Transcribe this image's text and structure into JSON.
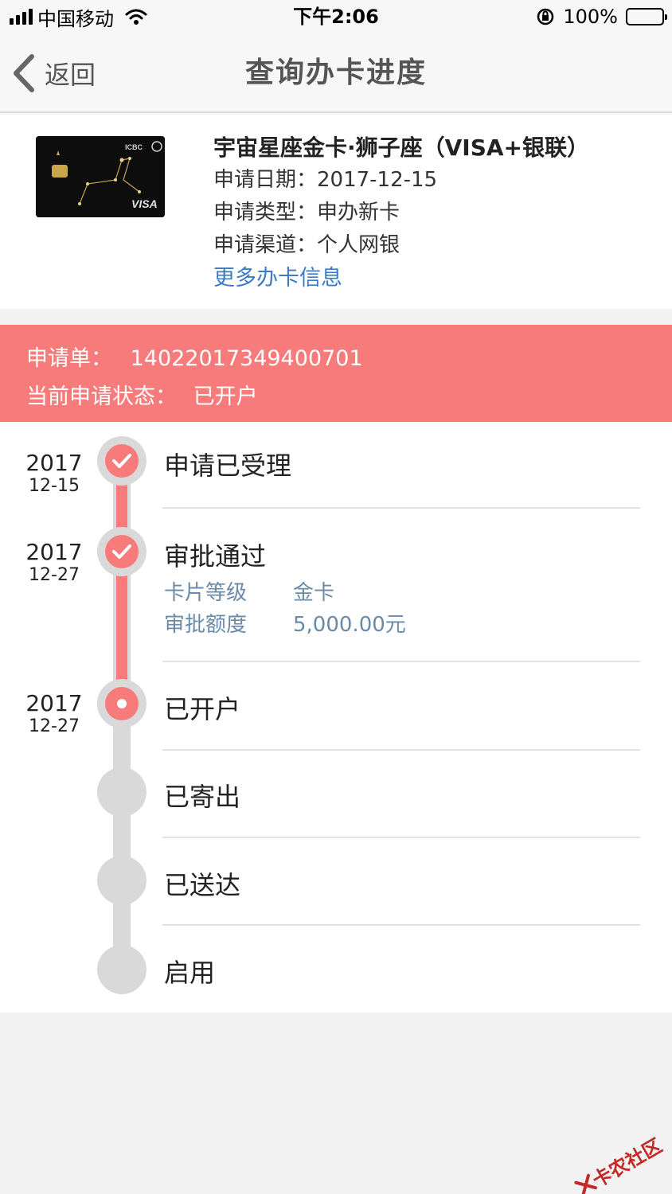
{
  "status_bar": {
    "carrier": "中国移动",
    "time": "下午2:06",
    "battery": "100%"
  },
  "nav": {
    "back_label": "返回",
    "title": "查询办卡进度"
  },
  "card": {
    "name": "宇宙星座金卡·狮子座（VISA+银联）",
    "image_text": {
      "bank": "ICBC",
      "brand": "VISA"
    },
    "apply_date": "申请日期：2017-12-15",
    "apply_type": "申请类型：申办新卡",
    "apply_channel": "申请渠道：个人网银",
    "more_link": "更多办卡信息"
  },
  "application": {
    "number_label": "申请单：",
    "number": "14022017349400701",
    "state_label": "当前申请状态：",
    "state": "已开户"
  },
  "timeline": {
    "steps": [
      {
        "title": "申请已受理",
        "year": "2017",
        "date": "12-15",
        "status": "done"
      },
      {
        "title": "审批通过",
        "year": "2017",
        "date": "12-27",
        "status": "done",
        "details": [
          {
            "key": "卡片等级",
            "value": "金卡"
          },
          {
            "key": "审批额度",
            "value": "5,000.00元"
          }
        ]
      },
      {
        "title": "已开户",
        "year": "2017",
        "date": "12-27",
        "status": "current"
      },
      {
        "title": "已寄出",
        "status": "pending"
      },
      {
        "title": "已送达",
        "status": "pending"
      },
      {
        "title": "启用",
        "status": "pending"
      }
    ]
  },
  "watermark": "卡农社区",
  "colors": {
    "accent": "#f77b7b",
    "link": "#3a7cc7",
    "rail_gray": "#d9d9d9"
  }
}
